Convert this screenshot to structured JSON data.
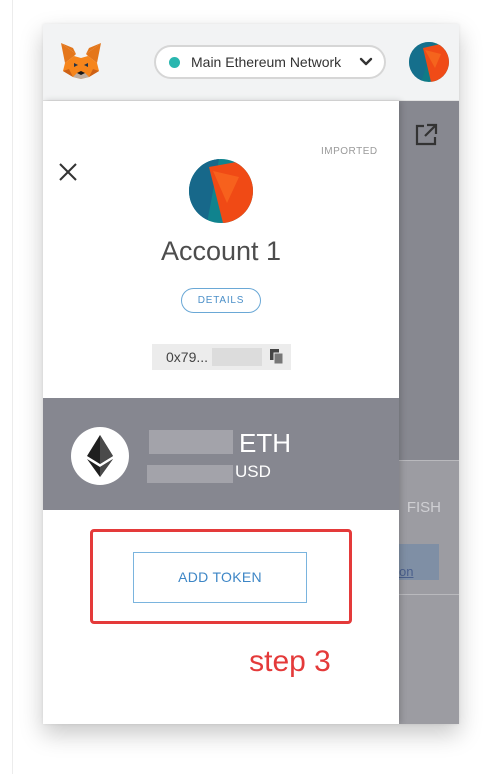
{
  "header": {
    "network_label": "Main Ethereum Network",
    "network_status_color": "#29b6af"
  },
  "drawer": {
    "badge": "IMPORTED",
    "account_name": "Account 1",
    "details_label": "DETAILS",
    "address_prefix": "0x79...",
    "icons": [
      "close-icon",
      "copy-icon",
      "external-link-icon",
      "ethereum-logo-icon",
      "fox-logo",
      "chevron-down-icon"
    ]
  },
  "balance": {
    "eth_unit": "ETH",
    "usd_unit": "USD"
  },
  "background_panel": {
    "fish_text": "FISH",
    "link_text": "on"
  },
  "actions": {
    "add_token_label": "ADD TOKEN"
  },
  "annotation": {
    "step_label": "step 3",
    "highlight_color": "#e43a3a"
  }
}
